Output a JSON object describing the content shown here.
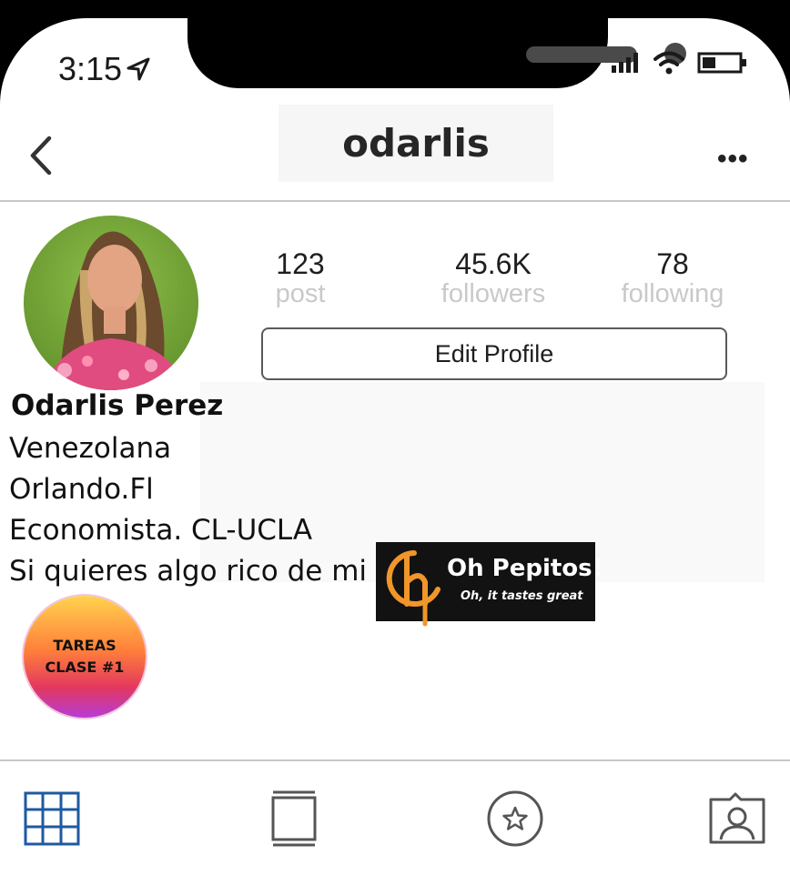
{
  "status_bar": {
    "time": "3:15"
  },
  "header": {
    "username": "odarlis"
  },
  "stats": [
    {
      "value": "123",
      "label": "post"
    },
    {
      "value": "45.6K",
      "label": "followers"
    },
    {
      "value": "78",
      "label": "following"
    }
  ],
  "edit_profile_label": "Edit Profile",
  "profile": {
    "full_name": "Odarlis Perez",
    "bio": [
      "Venezolana",
      "Orlando.Fl",
      "Economista. CL-UCLA",
      "Si quieres algo rico de mi"
    ]
  },
  "promo_logo": {
    "title": "Oh Pepitos!",
    "tagline": "Oh, it tastes great"
  },
  "highlight": {
    "line1": "TAREAS",
    "line2": "CLASE #1"
  },
  "tabs": [
    {
      "icon": "grid-icon"
    },
    {
      "icon": "igtv-icon"
    },
    {
      "icon": "star-icon"
    },
    {
      "icon": "tagged-person-icon"
    }
  ],
  "colors": {
    "accent_grid": "#1e5aa0",
    "stat_label": "#c9c9c9",
    "logo_orange": "#f0962a"
  }
}
